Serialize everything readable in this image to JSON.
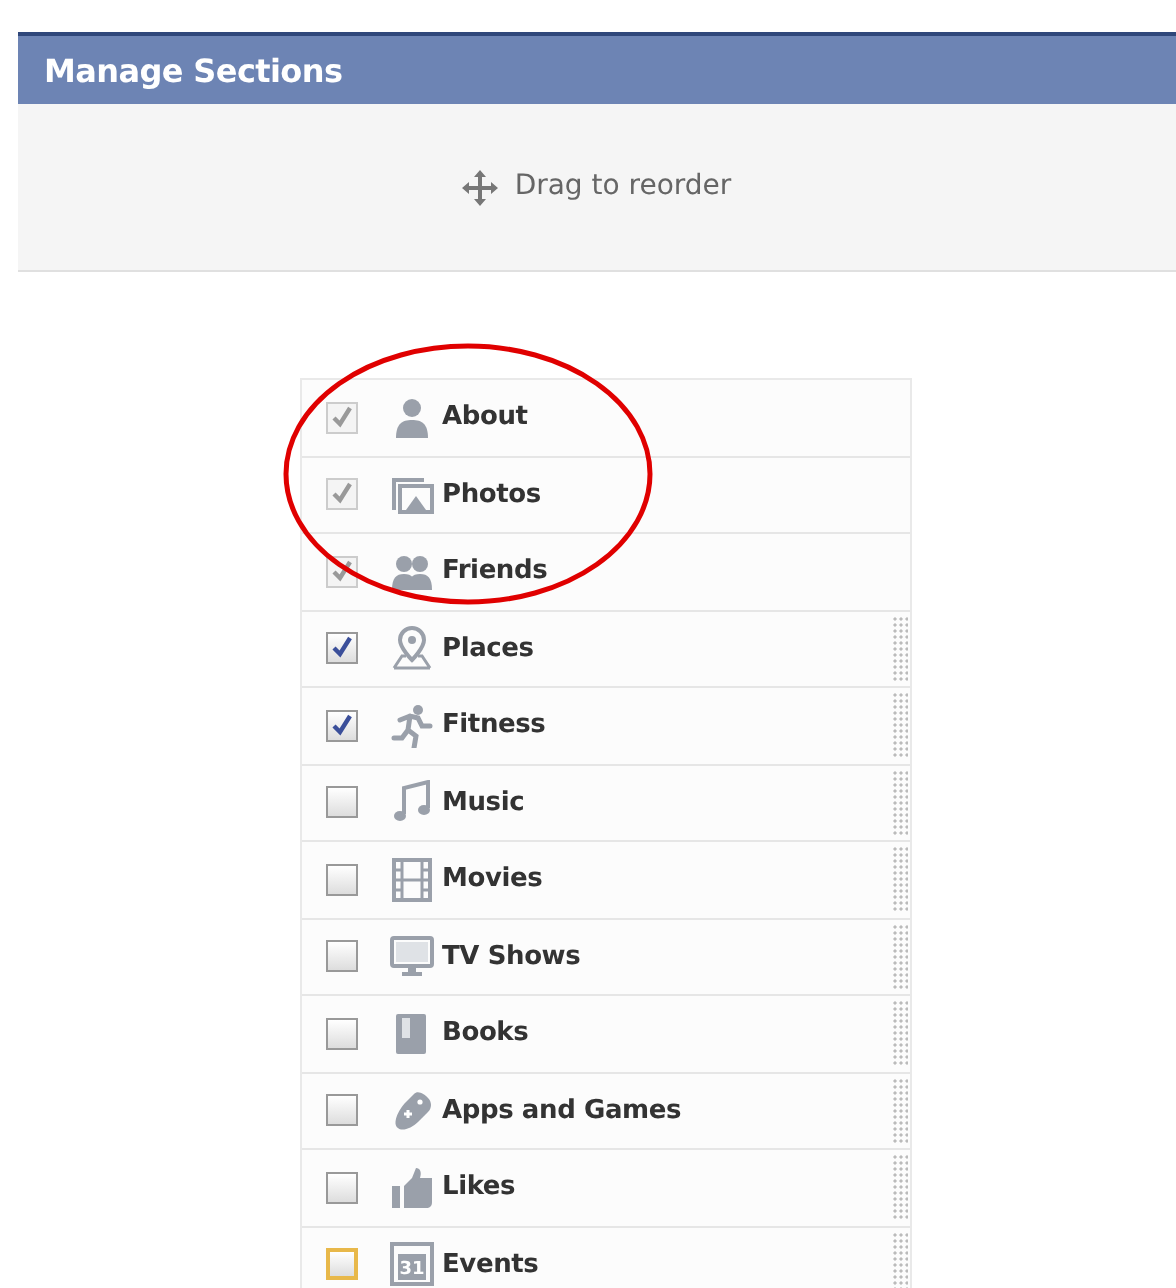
{
  "header": {
    "title": "Manage Sections"
  },
  "toolbar": {
    "hint": "Drag to reorder"
  },
  "sections": [
    {
      "label": "About",
      "kind": "person",
      "checked": true,
      "disabled": true,
      "focused": false
    },
    {
      "label": "Photos",
      "kind": "photos",
      "checked": true,
      "disabled": true,
      "focused": false
    },
    {
      "label": "Friends",
      "kind": "people",
      "checked": true,
      "disabled": true,
      "focused": false
    },
    {
      "label": "Places",
      "kind": "pin",
      "checked": true,
      "disabled": false,
      "focused": false
    },
    {
      "label": "Fitness",
      "kind": "runner",
      "checked": true,
      "disabled": false,
      "focused": false
    },
    {
      "label": "Music",
      "kind": "note",
      "checked": false,
      "disabled": false,
      "focused": false
    },
    {
      "label": "Movies",
      "kind": "film",
      "checked": false,
      "disabled": false,
      "focused": false
    },
    {
      "label": "TV Shows",
      "kind": "tv",
      "checked": false,
      "disabled": false,
      "focused": false
    },
    {
      "label": "Books",
      "kind": "book",
      "checked": false,
      "disabled": false,
      "focused": false
    },
    {
      "label": "Apps and Games",
      "kind": "gamepad",
      "checked": false,
      "disabled": false,
      "focused": false
    },
    {
      "label": "Likes",
      "kind": "thumb",
      "checked": false,
      "disabled": false,
      "focused": false
    },
    {
      "label": "Events",
      "kind": "calendar",
      "icon_text": "31",
      "checked": false,
      "disabled": false,
      "focused": true
    }
  ],
  "annotation": {
    "kind": "ellipse",
    "color": "#e00000"
  }
}
